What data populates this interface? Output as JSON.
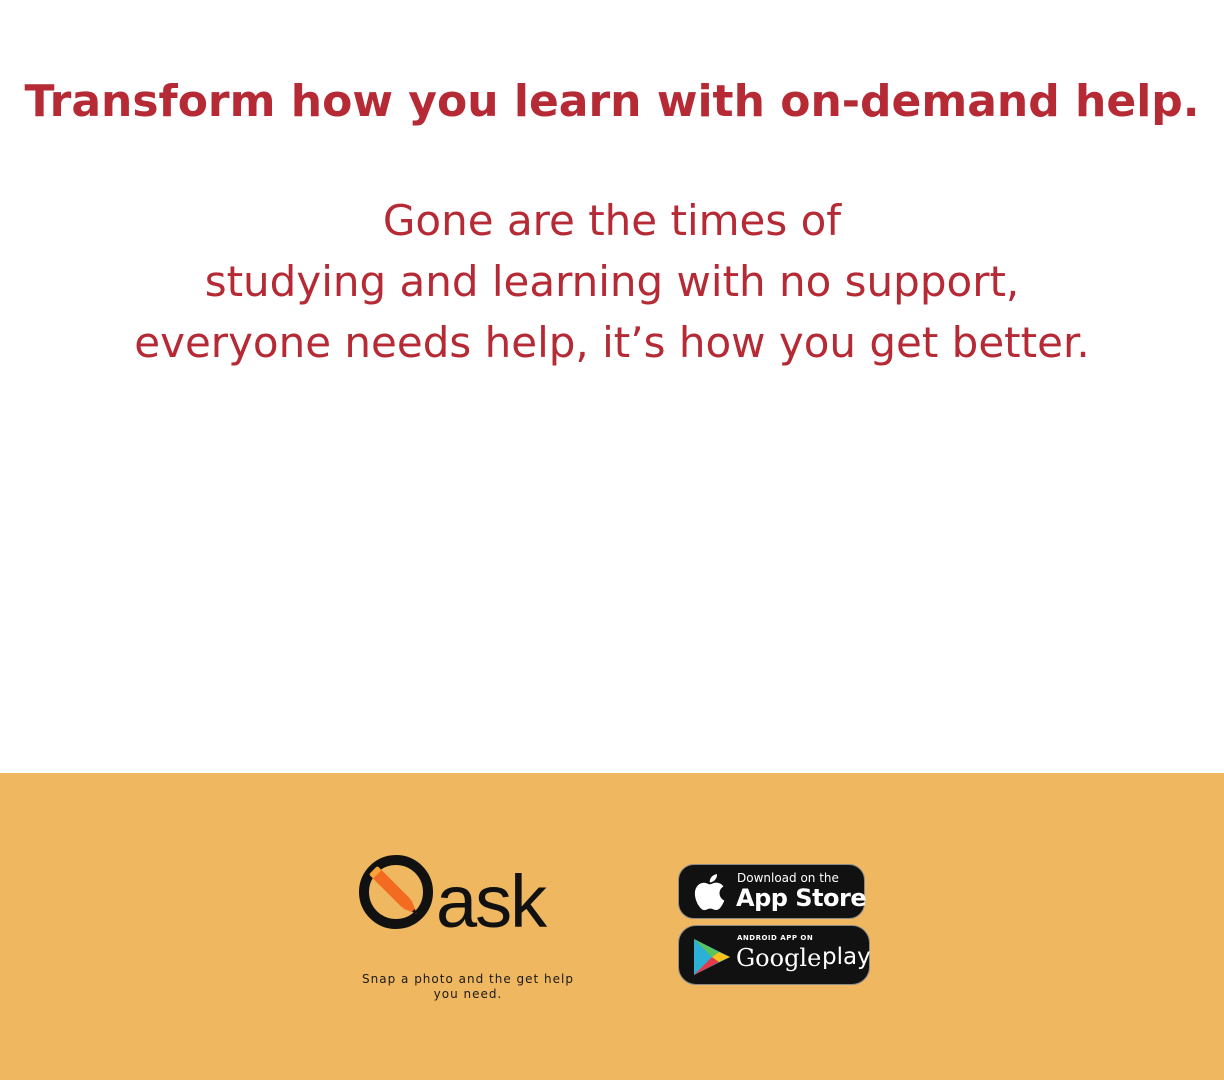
{
  "headline": "Transform how you learn with on-demand help.",
  "body": {
    "line1": "Gone are the times of",
    "line2": "studying and learning with no support,",
    "line3": "everyone needs help, it’s how you get better."
  },
  "brand": {
    "logo_text": "Qask",
    "tagline": "Snap a photo and the get help you need."
  },
  "app_store": {
    "small": "Download on the",
    "large": "App Store"
  },
  "google_play": {
    "small": "ANDROID APP ON",
    "large": "Google",
    "large2": "play"
  },
  "colors": {
    "text_red": "#b52a35",
    "footer_bg": "#efb75f",
    "pencil_orange": "#f36b21"
  }
}
